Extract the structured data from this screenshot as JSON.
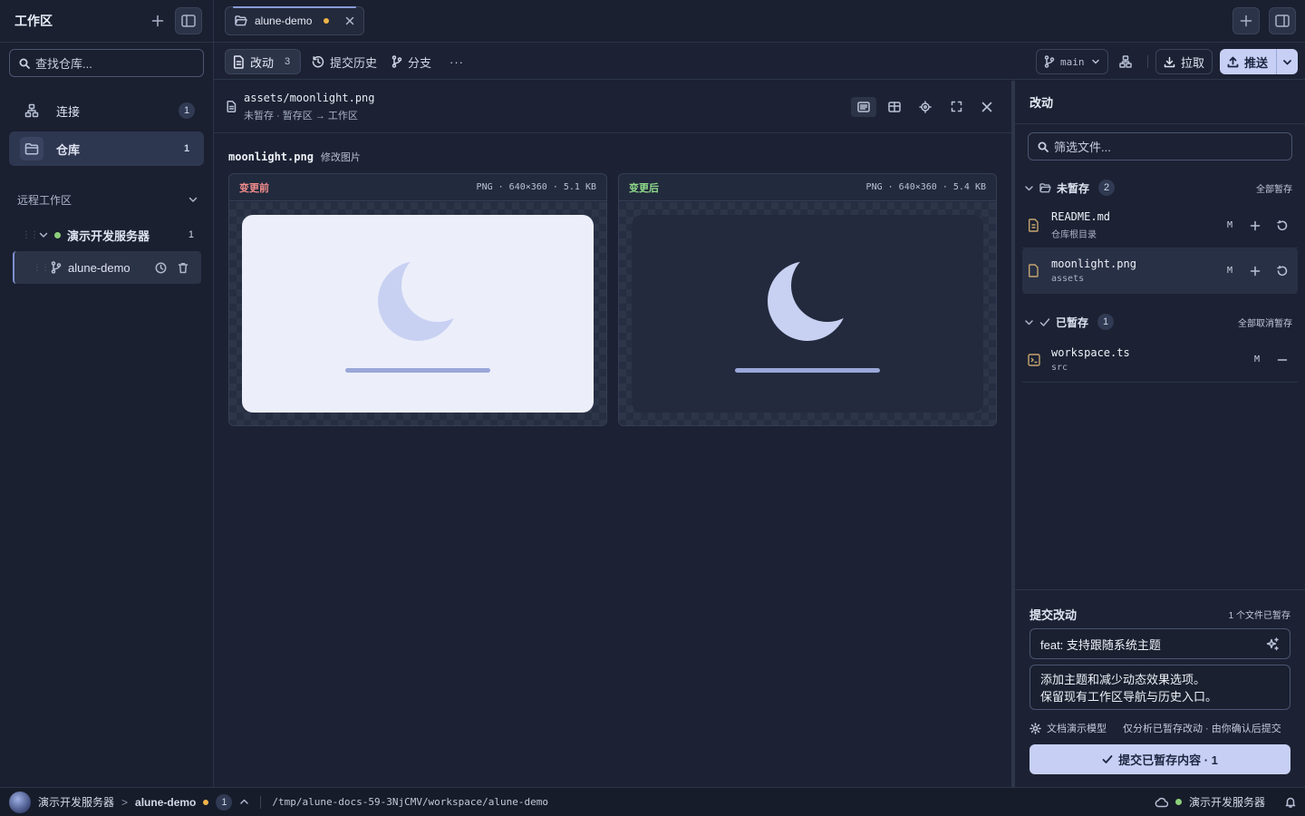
{
  "sidebar": {
    "title": "工作区",
    "search_placeholder": "查找仓库...",
    "nav": [
      {
        "label": "连接",
        "count": "1",
        "icon": "network-icon"
      },
      {
        "label": "仓库",
        "count": "1",
        "icon": "folder-icon"
      }
    ],
    "remote_section": "远程工作区",
    "server": {
      "label": "演示开发服务器",
      "count": "1",
      "status": "online"
    },
    "repo": {
      "label": "alune-demo"
    }
  },
  "tabs": [
    {
      "label": "alune-demo",
      "modified": true
    }
  ],
  "toolbar": {
    "changes_label": "改动",
    "changes_count": "3",
    "history_label": "提交历史",
    "branches_label": "分支",
    "more_label": "···",
    "branch": "main",
    "pull_label": "拉取",
    "push_label": "推送"
  },
  "diff": {
    "path": "assets/moonlight.png",
    "status_line": "未暂存 · 暂存区 → 工作区",
    "filename": "moonlight.png",
    "change_desc": "修改图片",
    "before": {
      "tag": "变更前",
      "meta": "PNG · 640×360 · 5.1 KB"
    },
    "after": {
      "tag": "变更后",
      "meta": "PNG · 640×360 · 5.4 KB"
    }
  },
  "changes": {
    "title": "改动",
    "filter_placeholder": "筛选文件...",
    "unstaged": {
      "label": "未暂存",
      "count": "2",
      "action": "全部暂存",
      "files": [
        {
          "name": "README.md",
          "dir": "仓库根目录",
          "status": "M"
        },
        {
          "name": "moonlight.png",
          "dir": "assets",
          "status": "M"
        }
      ]
    },
    "staged": {
      "label": "已暂存",
      "count": "1",
      "action": "全部取消暂存",
      "files": [
        {
          "name": "workspace.ts",
          "dir": "src",
          "status": "M"
        }
      ]
    }
  },
  "commit": {
    "title": "提交改动",
    "staged_note": "1 个文件已暂存",
    "summary": "feat: 支持跟随系统主题",
    "description_line1": "添加主题和减少动态效果选项。",
    "description_line2": "保留现有工作区导航与历史入口。",
    "model_label": "文档演示模型",
    "model_note": "仅分析已暂存改动 · 由你确认后提交",
    "button_label": "提交已暂存内容 · 1"
  },
  "statusbar": {
    "server": "演示开发服务器",
    "repo": "alune-demo",
    "count": "1",
    "path": "/tmp/alune-docs-59-3NjCMV/workspace/alune-demo",
    "right_server": "演示开发服务器"
  },
  "colors": {
    "accent": "#c7d0f4",
    "before_tag": "#f08c8c",
    "after_tag": "#8fd98a",
    "modified_dot": "#f0b44a",
    "online": "#8dd07a"
  }
}
